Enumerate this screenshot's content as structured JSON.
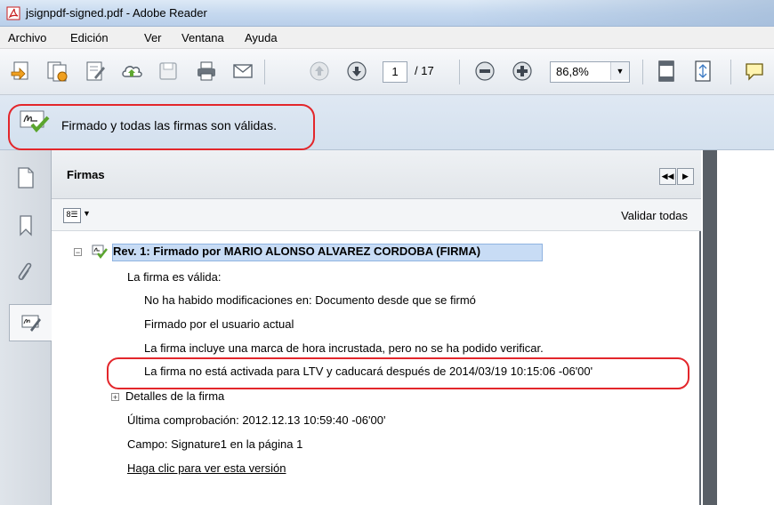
{
  "window": {
    "title": "jsignpdf-signed.pdf - Adobe Reader"
  },
  "menu": {
    "items": [
      "Archivo",
      "Edición",
      "Ver",
      "Ventana",
      "Ayuda"
    ]
  },
  "toolbar": {
    "current_page": "1",
    "total_pages": "/ 17",
    "zoom": "86,8%"
  },
  "notification": {
    "text": "Firmado y todas las firmas son válidas."
  },
  "panel": {
    "title": "Firmas",
    "validate_all": "Validar todas",
    "signature": {
      "heading": "Rev. 1: Firmado por MARIO ALONSO ALVAREZ CORDOBA (FIRMA)",
      "valid_label": "La firma es válida:",
      "details": [
        "No ha habido modificaciones en: Documento desde que se firmó",
        "Firmado por el usuario actual",
        "La firma incluye una marca de hora incrustada, pero no se ha podido verificar.",
        "La firma no está activada para LTV y caducará después de 2014/03/19 10:15:06 -06'00'"
      ],
      "signature_details": "Detalles de la firma",
      "last_checked": "Última comprobación: 2012.12.13 10:59:40 -06'00'",
      "field": "Campo: Signature1 en la página 1",
      "view_version": "Haga clic para ver esta versión"
    }
  },
  "colors": {
    "highlight": "#e3262b",
    "selection": "#c8dcf5",
    "accent": "#4a7bbd"
  }
}
